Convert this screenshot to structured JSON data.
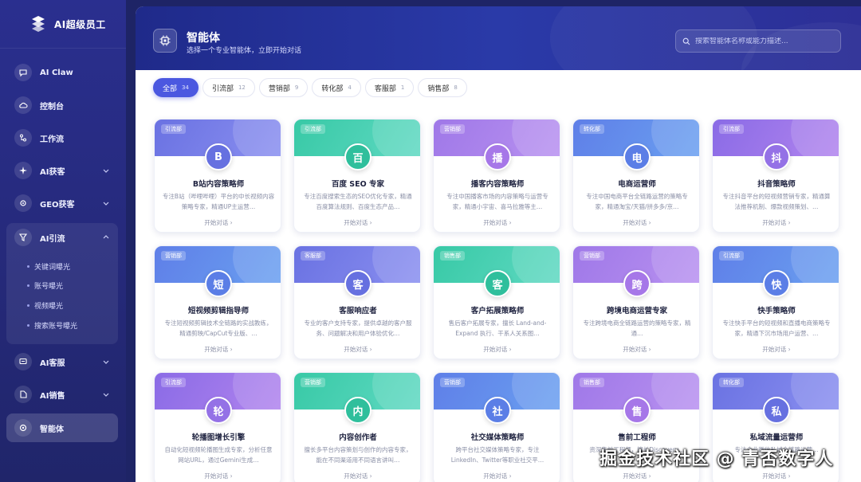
{
  "app": {
    "brand_name": "AI超级员工"
  },
  "sidebar": {
    "items": [
      {
        "label": "AI Claw",
        "icon": "chat-icon"
      },
      {
        "label": "控制台",
        "icon": "cloud-icon"
      },
      {
        "label": "工作流",
        "icon": "workflow-icon"
      },
      {
        "label": "AI获客",
        "icon": "sparkle-icon",
        "expandable": true
      },
      {
        "label": "GEO获客",
        "icon": "gear-icon",
        "expandable": true
      },
      {
        "label": "AI引流",
        "icon": "funnel-icon",
        "expandable": true,
        "expanded": true
      },
      {
        "label": "AI客服",
        "icon": "chat-bubble-icon",
        "expandable": true
      },
      {
        "label": "AI销售",
        "icon": "tag-icon",
        "expandable": true
      },
      {
        "label": "智能体",
        "icon": "bot-icon",
        "active": true
      }
    ],
    "sub_items": [
      "关键词曝光",
      "账号曝光",
      "视频曝光",
      "搜索账号曝光"
    ]
  },
  "header": {
    "title": "智能体",
    "subtitle": "选择一个专业智能体，立即开始对话",
    "search_placeholder": "搜索智能体名称或能力描述..."
  },
  "tabs": [
    {
      "label": "全部",
      "count": "34",
      "active": true
    },
    {
      "label": "引流部",
      "count": "12"
    },
    {
      "label": "营销部",
      "count": "9"
    },
    {
      "label": "转化部",
      "count": "4"
    },
    {
      "label": "客服部",
      "count": "1"
    },
    {
      "label": "销售部",
      "count": "8"
    }
  ],
  "card_cta": "开始对话 ›",
  "cards": [
    {
      "tag": "引流部",
      "initial": "B",
      "name": "B站内容策略师",
      "desc": "专注B站（哔哩哔哩）平台的中长视频内容策略专家，精通UP主运营…",
      "color": "indigo"
    },
    {
      "tag": "引流部",
      "initial": "百",
      "name": "百度 SEO 专家",
      "desc": "专注百度搜索生态的SEO优化专家，精通百度算法规则、百度生态产品…",
      "color": "teal"
    },
    {
      "tag": "营销部",
      "initial": "播",
      "name": "播客内容策略师",
      "desc": "专注中国播客市场的内容策略与运营专家，精通小宇宙、喜马拉雅等主…",
      "color": "purple"
    },
    {
      "tag": "转化部",
      "initial": "电",
      "name": "电商运营师",
      "desc": "专注中国电商平台全链路运营的策略专家，精通淘宝/天猫/拼多多/京…",
      "color": "blue"
    },
    {
      "tag": "引流部",
      "initial": "抖",
      "name": "抖音策略师",
      "desc": "专注抖音平台的短视频营销专家，精通算法推荐机制、爆款视频策划、…",
      "color": "violet"
    },
    {
      "tag": "营销部",
      "initial": "短",
      "name": "短视频剪辑指导师",
      "desc": "专注短视频剪辑技术全链路的实战教练，精通剪映/CapCut专业版、…",
      "color": "blue"
    },
    {
      "tag": "客服部",
      "initial": "客",
      "name": "客服响应者",
      "desc": "专业的客户支持专家，提供卓越的客户服务、问题解决和用户体验优化…",
      "color": "indigo"
    },
    {
      "tag": "销售部",
      "initial": "客",
      "name": "客户拓展策略师",
      "desc": "售后客户拓展专家，擅长 Land-and-Expand 执行、干系人关系图…",
      "color": "teal"
    },
    {
      "tag": "营销部",
      "initial": "跨",
      "name": "跨境电商运营专家",
      "desc": "专注跨境电商全链路运营的策略专家，精通…",
      "color": "purple"
    },
    {
      "tag": "引流部",
      "initial": "快",
      "name": "快手策略师",
      "desc": "专注快手平台的短视频和直播电商策略专家，精通下沉市场用户运营、…",
      "color": "blue"
    },
    {
      "tag": "引流部",
      "initial": "轮",
      "name": "轮播图增长引擎",
      "desc": "自动化短视频轮播图生成专家，分析任意网站URL，通过Gemini生成…",
      "color": "violet"
    },
    {
      "tag": "营销部",
      "initial": "内",
      "name": "内容创作者",
      "desc": "擅长多平台内容策划与创作的内容专家，能在不同渠道用不同语言讲叫…",
      "color": "teal"
    },
    {
      "tag": "营销部",
      "initial": "社",
      "name": "社交媒体策略师",
      "desc": "跨平台社交媒体策略专家，专注LinkedIn、Twitter等职业社交平…",
      "color": "blue"
    },
    {
      "tag": "销售部",
      "initial": "售",
      "name": "售前工程师",
      "desc": "资深售前工程师，擅长Discovery…",
      "color": "purple"
    },
    {
      "tag": "转化部",
      "initial": "私",
      "name": "私域流量运营师",
      "desc": "专注企业微信私域全链路运营…",
      "color": "indigo"
    }
  ],
  "watermark": "掘金技术社区 @ 青否数字人"
}
